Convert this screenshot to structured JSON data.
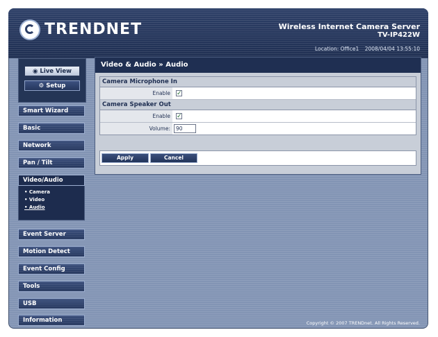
{
  "header": {
    "brand": "TRENDNET",
    "product_title": "Wireless Internet Camera Server",
    "model": "TV-IP422W",
    "location": "Location: Office1",
    "datetime": "2008/04/04 13:55:10"
  },
  "view_buttons": {
    "live_view": "Live View",
    "setup": "Setup"
  },
  "nav": {
    "items": [
      "Smart Wizard",
      "Basic",
      "Network",
      "Pan / Tilt",
      "Video/Audio",
      "Event Server",
      "Motion Detect",
      "Event Config",
      "Tools",
      "USB",
      "Information"
    ],
    "subitems": [
      "• Camera",
      "• Video",
      "• Audio"
    ]
  },
  "content": {
    "title": "Video & Audio » Audio",
    "mic_section": "Camera Microphone In",
    "mic_enable_label": "Enable",
    "speaker_section": "Camera Speaker Out",
    "speaker_enable_label": "Enable",
    "volume_label": "Volume:",
    "volume_value": "90",
    "checkmark": "✓",
    "apply": "Apply",
    "cancel": "Cancel"
  },
  "footer": {
    "copyright": "Copyright © 2007 TRENDnet. All Rights Reserved."
  }
}
